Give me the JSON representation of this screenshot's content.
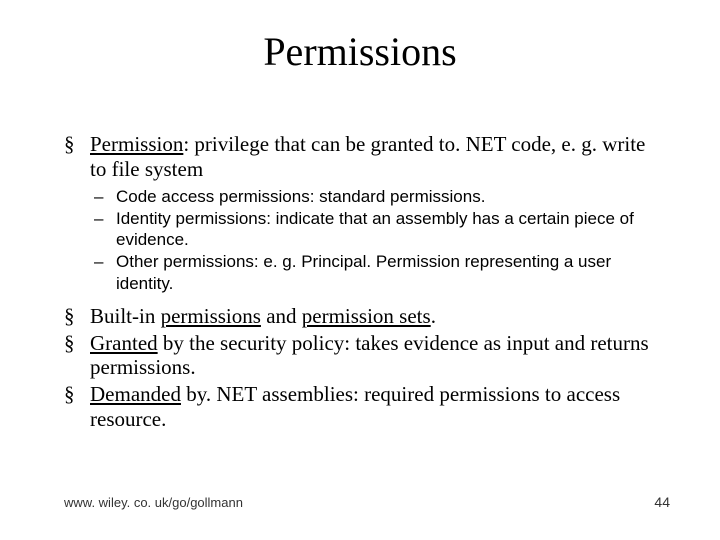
{
  "title": "Permissions",
  "bullets": {
    "b1": {
      "u": "Permission",
      "rest": ": privilege that can be granted to. NET code, e. g. write to file system"
    },
    "sub": {
      "s1": "Code access permissions: standard permissions.",
      "s2": "Identity permissions: indicate that an assembly has a certain piece of evidence.",
      "s3a": "Other permissions: e. g. ",
      "s3b": "Principal. Permission",
      "s3c": " representing a user identity."
    },
    "b2a": "Built-in ",
    "b2b": "permissions",
    "b2c": " and ",
    "b2d": "permission sets",
    "b2e": ".",
    "b3a": "Granted",
    "b3b": " by the security policy: takes evidence as input and returns permissions.",
    "b4a": "Demanded",
    "b4b": " by. NET assemblies: required permissions to access resource."
  },
  "footer": {
    "left": "www. wiley. co. uk/go/gollmann",
    "right": "44"
  }
}
